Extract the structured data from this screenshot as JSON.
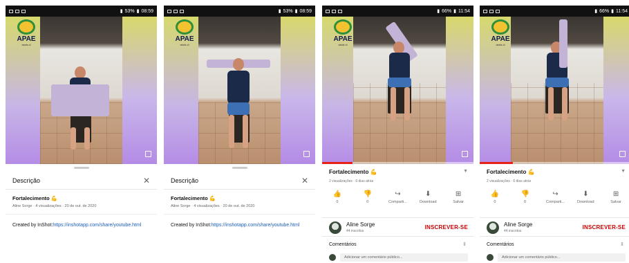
{
  "screens": [
    {
      "status": {
        "left_icons": [
          "notification-icon",
          "notification-icon",
          "gallery-icon"
        ],
        "right_text": "53%",
        "time": "08:59"
      },
      "logo": {
        "text": "APAE",
        "subtext": "assis.cl"
      },
      "video": {
        "progress": 0
      },
      "sheet": {
        "title": "Descrição",
        "video_title": "Fortalecimento 💪",
        "meta": "Aline Sorge · 4 visualizações · 20 de out. de 2020",
        "body_prefix": "Created by InShot:",
        "body_link": "https://inshotapp.com/share/youtube.html"
      }
    },
    {
      "status": {
        "left_icons": [
          "notification-icon",
          "notification-icon",
          "gallery-icon"
        ],
        "right_text": "53%",
        "time": "08:59"
      },
      "logo": {
        "text": "APAE",
        "subtext": "assis.cl"
      },
      "video": {
        "progress": 0
      },
      "sheet": {
        "title": "Descrição",
        "video_title": "Fortalecimento 💪",
        "meta": "Aline Sorge · 4 visualizações · 20 de out. de 2020",
        "body_prefix": "Created by InShot:",
        "body_link": "https://inshotapp.com/share/youtube.html"
      }
    },
    {
      "status": {
        "left_icons": [
          "notification-icon",
          "whatsapp-icon",
          "chat-icon"
        ],
        "right_text": "66%",
        "time": "11:54"
      },
      "logo": {
        "text": "APAE",
        "subtext": "assis.cl"
      },
      "video": {
        "progress": 0.2
      },
      "info": {
        "title": "Fortalecimento 💪",
        "meta": "2 visualizações · 6 dias atrás",
        "actions": [
          {
            "icon": "👍",
            "label": "0"
          },
          {
            "icon": "👎",
            "label": "0"
          },
          {
            "icon": "↪",
            "label": "Comparti..."
          },
          {
            "icon": "⬇",
            "label": "Download"
          },
          {
            "icon": "⊞",
            "label": "Salvar"
          }
        ],
        "channel_name": "Aline Sorge",
        "channel_subs": "44 inscritos",
        "subscribe": "INSCREVER-SE",
        "comments_label": "Comentários",
        "comment_placeholder": "Adicionar um comentário público..."
      }
    },
    {
      "status": {
        "left_icons": [
          "notification-icon",
          "whatsapp-icon",
          "chat-icon"
        ],
        "right_text": "66%",
        "time": "11:54"
      },
      "logo": {
        "text": "APAE",
        "subtext": "assis.cl"
      },
      "video": {
        "progress": 0.22
      },
      "info": {
        "title": "Fortalecimento 💪",
        "meta": "2 visualizações · 6 dias atrás",
        "actions": [
          {
            "icon": "👍",
            "label": "0"
          },
          {
            "icon": "👎",
            "label": "0"
          },
          {
            "icon": "↪",
            "label": "Comparti..."
          },
          {
            "icon": "⬇",
            "label": "Download"
          },
          {
            "icon": "⊞",
            "label": "Salvar"
          }
        ],
        "channel_name": "Aline Sorge",
        "channel_subs": "44 inscritos",
        "subscribe": "INSCREVER-SE",
        "comments_label": "Comentários",
        "comment_placeholder": "Adicionar um comentário público..."
      }
    }
  ]
}
